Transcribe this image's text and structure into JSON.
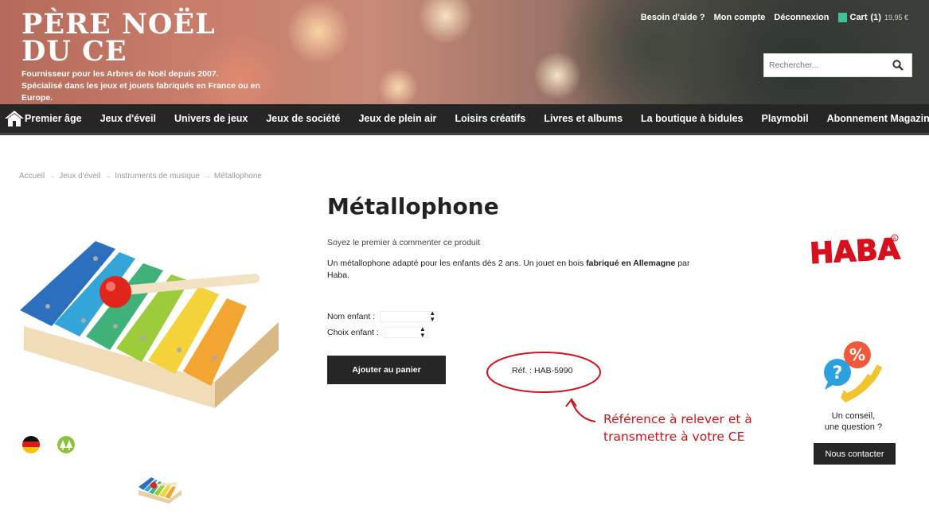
{
  "header": {
    "logo_line1": "PÈRE NOËL",
    "logo_line2": "DU CE",
    "tagline1": "Fournisseur pour les Arbres de Noël depuis 2007.",
    "tagline2": "Spécialisé dans les jeux et jouets fabriqués en France ou en Europe.",
    "links": {
      "help": "Besoin d'aide ?",
      "account": "Mon compte",
      "logout": "Déconnexion",
      "cart": "Cart",
      "cart_count": "(1)",
      "cart_total": "19,95 €"
    },
    "search_placeholder": "Rechercher..."
  },
  "nav": {
    "items": [
      "Premier âge",
      "Jeux d'éveil",
      "Univers de jeux",
      "Jeux de société",
      "Jeux de plein air",
      "Loisirs créatifs",
      "Livres et albums",
      "La boutique à bidules",
      "Playmobil",
      "Abonnement Magazine"
    ]
  },
  "breadcrumb": [
    "Accueil",
    "Jeux d'éveil",
    "Instruments de musique",
    "Métallophone"
  ],
  "product": {
    "title": "Métallophone",
    "review_link": "Soyez le premier à commenter ce produit",
    "desc_part1": "Un métallophone adapté pour les enfants dès 2 ans. Un jouet en bois ",
    "desc_bold": "fabriqué en Allemagne",
    "desc_part2": " par Haba.",
    "option1_label": "Nom enfant :",
    "option2_label": "Choix enfant :",
    "add_to_cart": "Ajouter au panier",
    "reference": "Réf. : HAB-5990"
  },
  "annotation": {
    "line1": "Référence à relever et à",
    "line2": "transmettre à votre CE",
    "color": "#d0121a"
  },
  "sidebar": {
    "brand": "HABA",
    "help_line1": "Un conseil,",
    "help_line2": "une question ?",
    "contact_button": "Nous contacter"
  }
}
